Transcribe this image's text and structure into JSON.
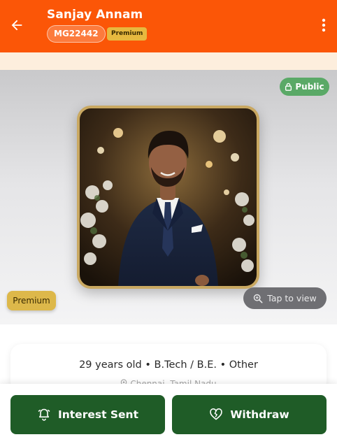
{
  "header": {
    "title": "Sanjay Annam",
    "profile_id": "MG22442",
    "membership_chip": "Premium"
  },
  "photo": {
    "visibility_label": "Public",
    "membership_label": "Premium",
    "tap_hint": "Tap to view"
  },
  "info": {
    "summary": "29 years old • B.Tech / B.E. • Other",
    "location": "Chennai, Tamil Nadu"
  },
  "actions": {
    "interest_label": "Interest Sent",
    "withdraw_label": "Withdraw"
  },
  "colors": {
    "header": "#fb5607",
    "action_green": "#1f5c27",
    "public_green": "#5aa967",
    "premium_gold": "#ddb84a"
  }
}
